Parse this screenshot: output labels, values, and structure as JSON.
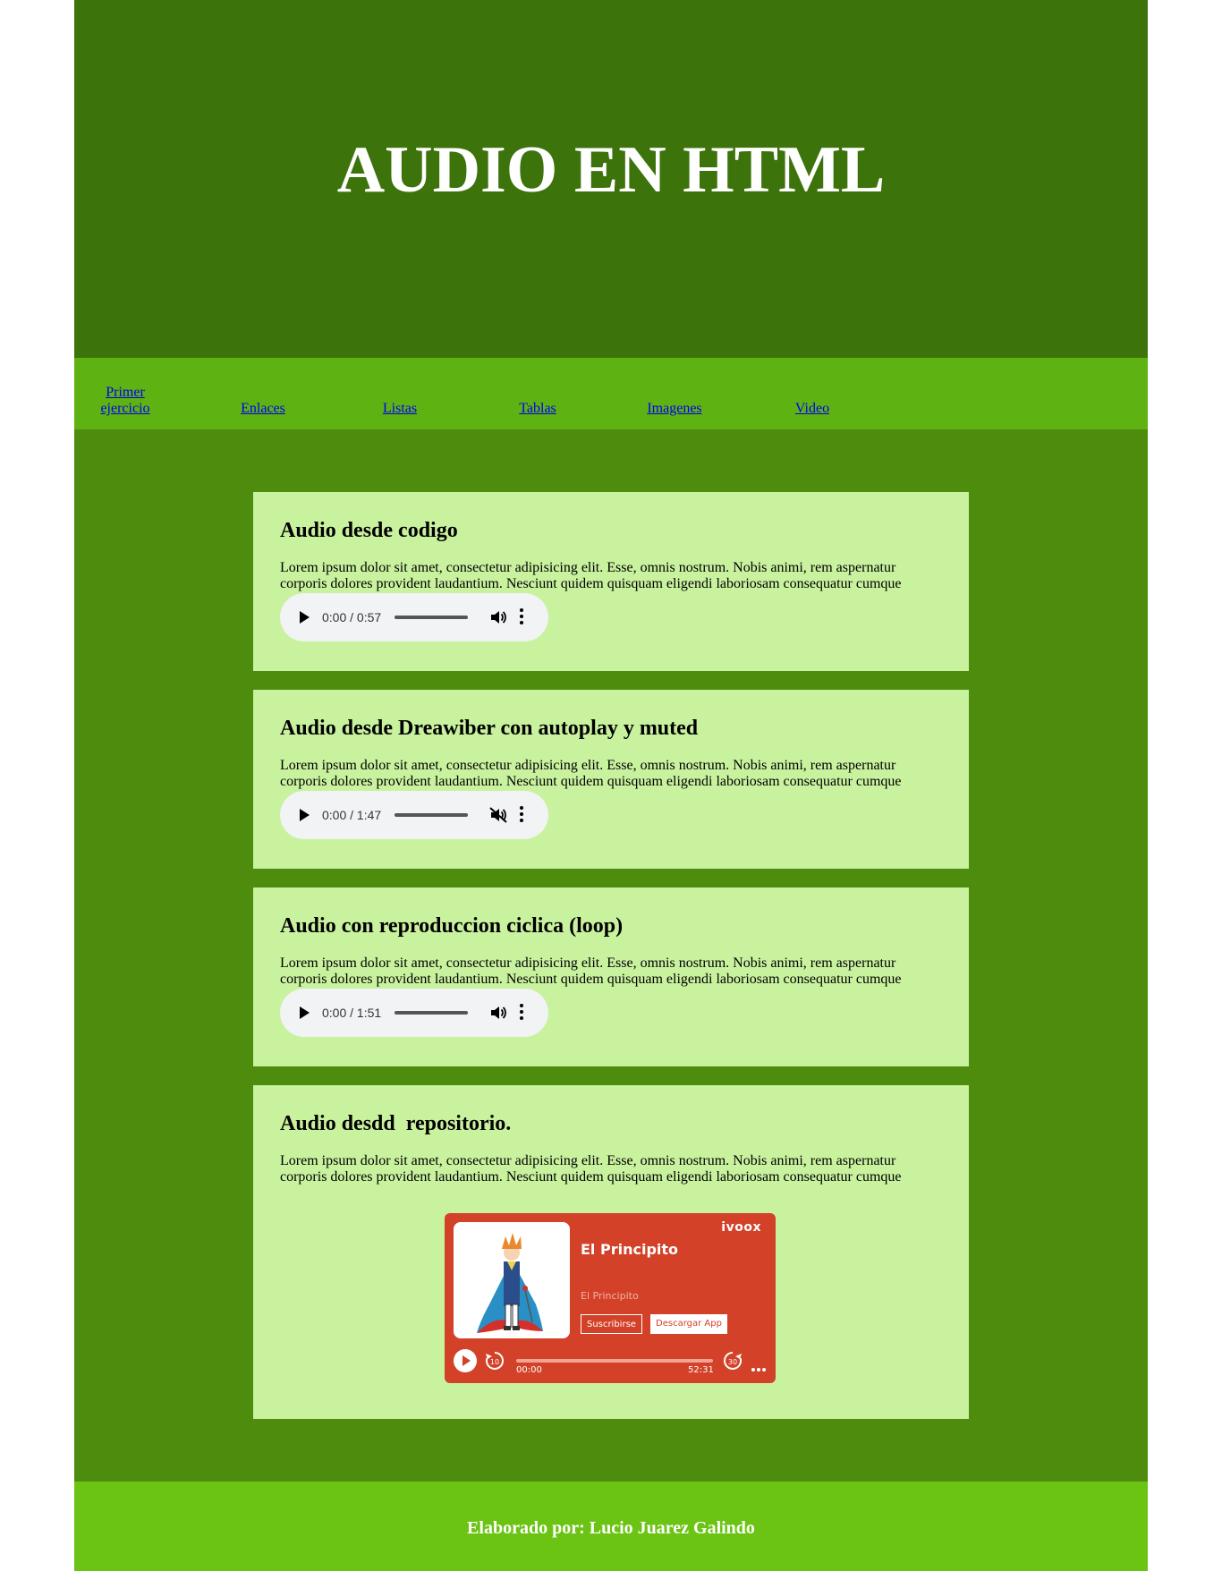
{
  "header": {
    "title": "AUDIO EN HTML"
  },
  "nav": {
    "items": [
      {
        "label": "Primer ejercicio"
      },
      {
        "label": "Enlaces"
      },
      {
        "label": "Listas"
      },
      {
        "label": "Tablas"
      },
      {
        "label": "Imagenes"
      },
      {
        "label": "Video"
      }
    ]
  },
  "sections": [
    {
      "title": "Audio desde codigo",
      "text": "Lorem ipsum dolor sit amet, consectetur adipisicing elit. Esse, omnis nostrum. Nobis animi, rem aspernatur corporis dolores provident laudantium. Nesciunt quidem quisquam eligendi laboriosam consequatur cumque",
      "audio": {
        "time": "0:00 / 0:57",
        "muted": false
      }
    },
    {
      "title": "Audio desde Dreawiber con autoplay y muted",
      "text": "Lorem ipsum dolor sit amet, consectetur adipisicing elit. Esse, omnis nostrum. Nobis animi, rem aspernatur corporis dolores provident laudantium. Nesciunt quidem quisquam eligendi laboriosam consequatur cumque",
      "audio": {
        "time": "0:00 / 1:47",
        "muted": true
      }
    },
    {
      "title": "Audio con reproduccion ciclica (loop)",
      "text": "Lorem ipsum dolor sit amet, consectetur adipisicing elit. Esse, omnis nostrum. Nobis animi, rem aspernatur corporis dolores provident laudantium. Nesciunt quidem quisquam eligendi laboriosam consequatur cumque",
      "audio": {
        "time": "0:00 / 1:51",
        "muted": false
      }
    },
    {
      "title": "Audio desdd  repositorio.",
      "text": "Lorem ipsum dolor sit amet, consectetur adipisicing elit. Esse, omnis nostrum. Nobis animi, rem aspernatur corporis dolores provident laudantium. Nesciunt quidem quisquam eligendi laboriosam consequatur cumque"
    }
  ],
  "ivoox": {
    "brand": "ivoox",
    "title": "El Principito",
    "subtitle": "El Principito",
    "subscribe_label": "Suscribirse",
    "download_label": "Descargar App",
    "current_time": "00:00",
    "duration": "52:31",
    "rewind_label": "10",
    "forward_label": "30"
  },
  "footer": {
    "text": "Elaborado por: Lucio Juarez Galindo"
  },
  "colors": {
    "header_bg": "#3d730b",
    "nav_bg": "#5eb312",
    "page_bg": "#4e8c0e",
    "card_bg": "#c9f29f",
    "footer_bg": "#6bc413",
    "ivoox_bg": "#d34128"
  }
}
